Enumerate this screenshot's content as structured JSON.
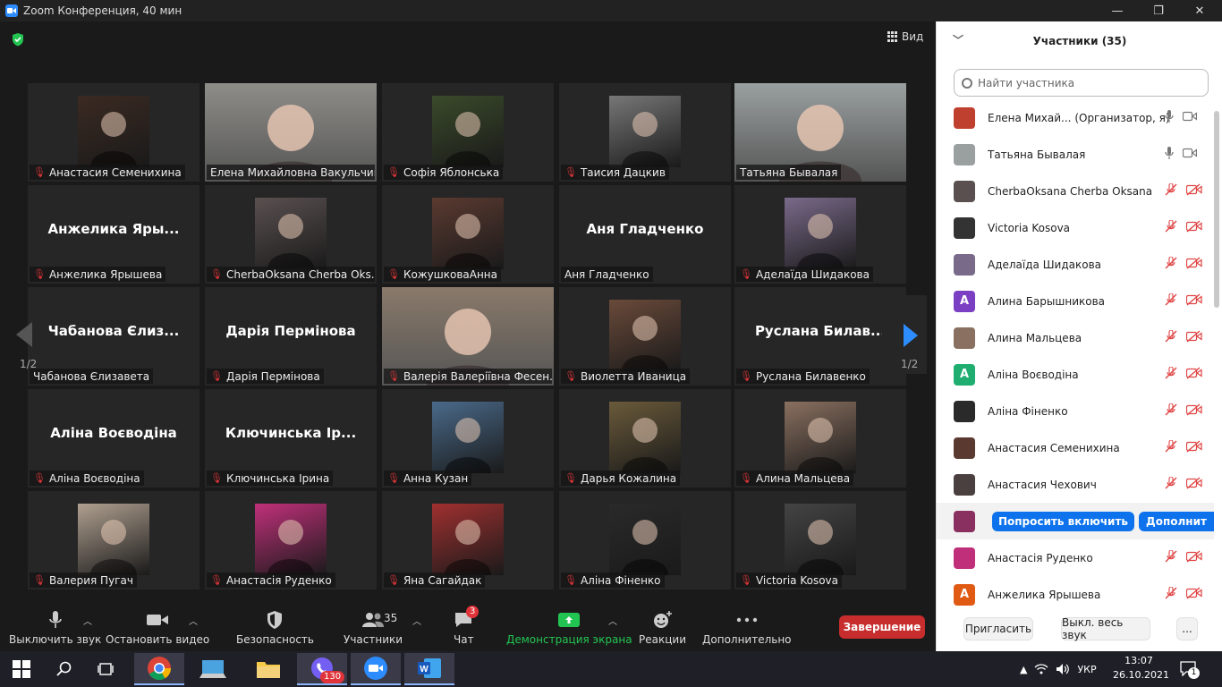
{
  "window": {
    "title": "Zoom Конференция, 40 мин",
    "minimize": "—",
    "restore": "❐",
    "close": "✕"
  },
  "view_label": "Вид",
  "pager": {
    "left": "1/2",
    "right": "1/2"
  },
  "tiles": [
    {
      "label": "Анастасия Семенихина",
      "muted": true,
      "video": "photo",
      "color": "#3b2a22"
    },
    {
      "label": "Елена Михайловна Вакульчик",
      "muted": false,
      "video": "full",
      "color": "#8e8d88"
    },
    {
      "label": "Софія Яблонська",
      "muted": true,
      "video": "photo",
      "color": "#3a4a2a"
    },
    {
      "label": "Таисия Дацкив",
      "muted": true,
      "video": "photo",
      "color": "#777777"
    },
    {
      "label": "Татьяна Бывалая",
      "muted": false,
      "video": "full",
      "color": "#9aa0a0",
      "active": true
    },
    {
      "label": "Анжелика Ярышева",
      "muted": true,
      "video": "name",
      "bigname": "Анжелика Яры..."
    },
    {
      "label": "CherbaOksana Cherba Oks...",
      "muted": true,
      "video": "photo",
      "color": "#5a5050"
    },
    {
      "label": "КожушковаАнна",
      "muted": true,
      "video": "photo",
      "color": "#5a3a30"
    },
    {
      "label": "Аня Гладченко",
      "muted": false,
      "video": "name",
      "bigname": "Аня Гладченко"
    },
    {
      "label": "Аделаїда Шидакова",
      "muted": true,
      "video": "photo",
      "color": "#7a6a8a"
    },
    {
      "label": "Чабанова Єлизавета",
      "muted": false,
      "video": "name",
      "bigname": "Чабанова Єлиз..."
    },
    {
      "label": "Дарія Пермінова",
      "muted": true,
      "video": "name",
      "bigname": "Дарія Пермінова"
    },
    {
      "label": "Валерія Валеріївна Фесен...",
      "muted": true,
      "video": "full",
      "color": "#8a7a6a"
    },
    {
      "label": "Виолетта Иваница",
      "muted": true,
      "video": "photo",
      "color": "#6a4a3a"
    },
    {
      "label": "Руслана Билавенко",
      "muted": true,
      "video": "name",
      "bigname": "Руслана  Билав..."
    },
    {
      "label": "Аліна Воєводіна",
      "muted": true,
      "video": "name",
      "bigname": "Аліна Воєводіна"
    },
    {
      "label": "Ключинська Ірина",
      "muted": true,
      "video": "name",
      "bigname": "Ключинська Ір..."
    },
    {
      "label": "Анна Кузан",
      "muted": true,
      "video": "photo",
      "color": "#4a6a8a"
    },
    {
      "label": "Дарья Кожалина",
      "muted": true,
      "video": "photo",
      "color": "#6a5a3a"
    },
    {
      "label": "Алина Мальцева",
      "muted": true,
      "video": "photo",
      "color": "#8a7060"
    },
    {
      "label": "Валерия Пугач",
      "muted": true,
      "video": "photo",
      "color": "#b0a090"
    },
    {
      "label": "Анастасія Руденко",
      "muted": true,
      "video": "photo",
      "color": "#c0307a"
    },
    {
      "label": "Яна Сагайдак",
      "muted": true,
      "video": "photo",
      "color": "#a03030"
    },
    {
      "label": "Аліна Фіненко",
      "muted": true,
      "video": "photo",
      "color": "#2a2a2a"
    },
    {
      "label": "Victoria Kosova",
      "muted": true,
      "video": "photo",
      "color": "#444444"
    }
  ],
  "toolbar": {
    "mute": "Выключить звук",
    "video": "Остановить видео",
    "security": "Безопасность",
    "participants": "Участники",
    "participants_count": "35",
    "chat": "Чат",
    "chat_badge": "3",
    "share": "Демонстрация экрана",
    "reactions": "Реакции",
    "more": "Дополнительно",
    "end": "Завершение"
  },
  "panel": {
    "title": "Участники (35)",
    "search_placeholder": "Найти участника",
    "participants": [
      {
        "name": "Елена Михай...  (Организатор, я)",
        "mic": "on",
        "cam": "on",
        "avatar_color": "#c04030",
        "initial": ""
      },
      {
        "name": "Татьяна Бывалая",
        "mic": "on",
        "cam": "on",
        "avatar_color": "#9aa0a0",
        "initial": ""
      },
      {
        "name": "CherbaOksana Cherba Oksana",
        "mic": "off",
        "cam": "off",
        "avatar_color": "#5a5050",
        "initial": ""
      },
      {
        "name": "Victoria Kosova",
        "mic": "off",
        "cam": "off",
        "avatar_color": "#333333",
        "initial": ""
      },
      {
        "name": "Аделаїда Шидакова",
        "mic": "off",
        "cam": "off",
        "avatar_color": "#7a6a8a",
        "initial": ""
      },
      {
        "name": "Алина Барышникова",
        "mic": "off",
        "cam": "off",
        "avatar_color": "#7b3fc4",
        "initial": "А"
      },
      {
        "name": "Алина Мальцева",
        "mic": "off",
        "cam": "off",
        "avatar_color": "#8a7060",
        "initial": ""
      },
      {
        "name": "Аліна Воєводіна",
        "mic": "off",
        "cam": "off",
        "avatar_color": "#1fae6f",
        "initial": "А"
      },
      {
        "name": "Аліна Фіненко",
        "mic": "off",
        "cam": "off",
        "avatar_color": "#2a2a2a",
        "initial": ""
      },
      {
        "name": "Анастасия Семенихина",
        "mic": "off",
        "cam": "off",
        "avatar_color": "#5a3a30",
        "initial": ""
      },
      {
        "name": "Анастасия Чехович",
        "mic": "off",
        "cam": "off",
        "avatar_color": "#4a4040",
        "initial": ""
      },
      {
        "name": "",
        "mic": "",
        "cam": "",
        "avatar_color": "#8a3060",
        "initial": "",
        "actions": true
      },
      {
        "name": "Анастасія Руденко",
        "mic": "off",
        "cam": "off",
        "avatar_color": "#c0307a",
        "initial": ""
      },
      {
        "name": "Анжелика Ярышева",
        "mic": "off",
        "cam": "off",
        "avatar_color": "#e05a14",
        "initial": "А"
      }
    ],
    "ask_unmute": "Попросить включить",
    "more_btn": "Дополнит",
    "invite": "Пригласить",
    "mute_all": "Выкл. весь звук",
    "ellipsis": "..."
  },
  "taskbar": {
    "viber_badge": "130",
    "lang": "УКР",
    "time": "13:07",
    "date": "26.10.2021",
    "notif": "1"
  }
}
